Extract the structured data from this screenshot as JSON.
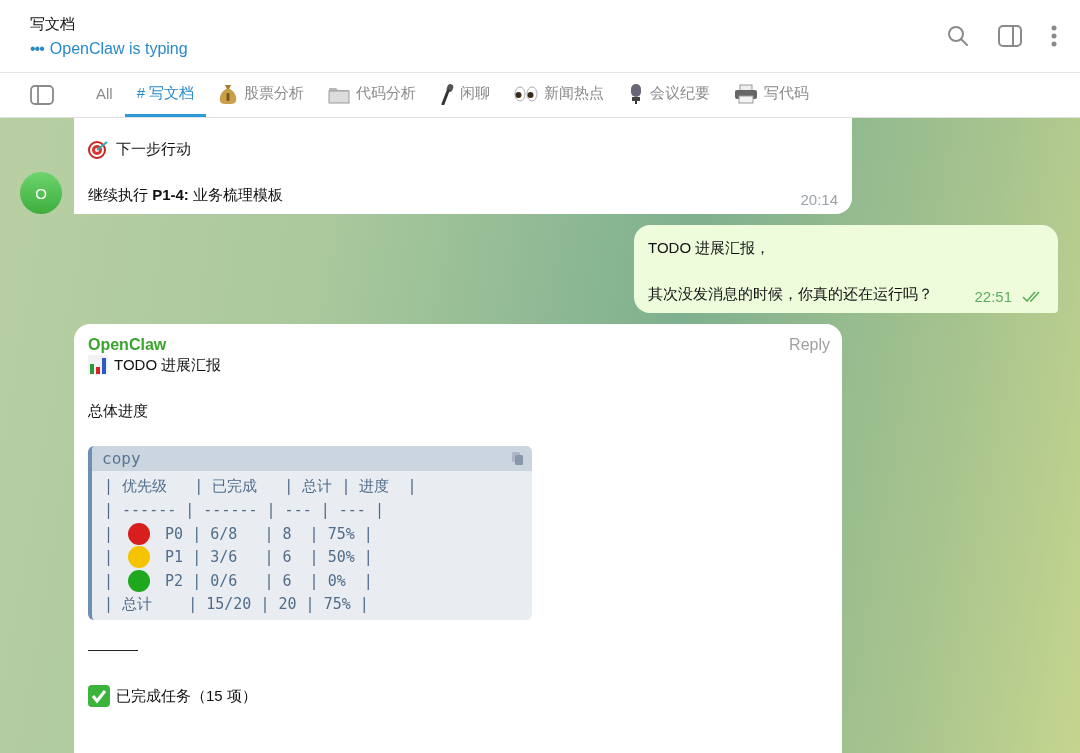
{
  "header": {
    "title": "写文档",
    "typing_dots": "•••",
    "status": "OpenClaw is typing"
  },
  "tabs": [
    {
      "label": "All",
      "selected": false
    },
    {
      "label": "# 写文档",
      "selected": true
    },
    {
      "label": "股票分析",
      "selected": false
    },
    {
      "label": "代码分析",
      "selected": false
    },
    {
      "label": "闲聊",
      "selected": false
    },
    {
      "label": "新闻热点",
      "selected": false
    },
    {
      "label": "会议纪要",
      "selected": false
    },
    {
      "label": "写代码",
      "selected": false
    }
  ],
  "messages": [
    {
      "kind": "incoming",
      "avatar": "O",
      "paragraphs": [
        {
          "text": "下一步行动"
        },
        {
          "text": "继续执行 **P1-4:** 业务梳理模板"
        }
      ],
      "time": "20:14"
    },
    {
      "kind": "outgoing",
      "paragraphs": [
        {
          "text": "TODO 进展汇报，"
        },
        {
          "text": "其次没发消息的时候，你真的还在运行吗？"
        }
      ],
      "time": "22:51",
      "read": true
    },
    {
      "kind": "report",
      "sender": "OpenClaw",
      "reply": "Reply",
      "title": "TODO 进展汇报",
      "subtitle": "总体进度",
      "code": {
        "language": "copy",
        "lines": [
          {
            "text": "| 优先级   | 已完成   | 总计 | 进度  |"
          },
          {
            "text": "| ------ | ------ | --- | --- |"
          },
          {
            "prefix": "| ",
            "color": "#d91e1e",
            "text": " P0 | 6/8   | 8  | 75% |"
          },
          {
            "prefix": "| ",
            "color": "#f5c400",
            "text": " P1 | 3/6   | 6  | 50% |"
          },
          {
            "prefix": "| ",
            "color": "#1ea81e",
            "text": " P2 | 0/6   | 6  | 0%  |"
          },
          {
            "text": "| 总计    | 15/20 | 20 | 75% |"
          }
        ]
      },
      "done": "已完成任务（15 项）"
    }
  ]
}
